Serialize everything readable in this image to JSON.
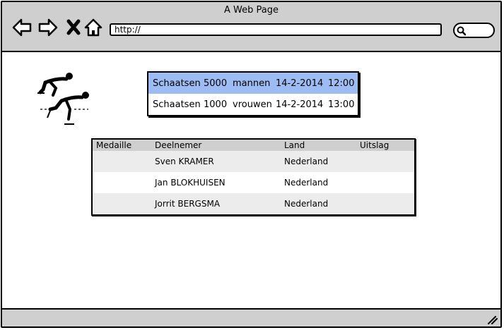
{
  "browser": {
    "title": "A Web Page",
    "url": "http://"
  },
  "events": [
    {
      "sport": "Schaatsen",
      "distance": "5000",
      "category": "mannen",
      "date": "14-2-2014",
      "time": "12:00",
      "selected": true
    },
    {
      "sport": "Schaatsen",
      "distance": "1000",
      "category": "vrouwen",
      "date": "14-2-2014",
      "time": "13:00",
      "selected": false
    }
  ],
  "results": {
    "headers": [
      "Medaille",
      "Deelnemer",
      "Land",
      "Uitslag"
    ],
    "rows": [
      {
        "medal": "",
        "participant": "Sven KRAMER",
        "country": "Nederland",
        "result": ""
      },
      {
        "medal": "",
        "participant": "Jan BLOKHUISEN",
        "country": "Nederland",
        "result": ""
      },
      {
        "medal": "",
        "participant": "Jorrit BERGSMA",
        "country": "Nederland",
        "result": ""
      }
    ]
  },
  "colors": {
    "chrome": "#cfcfcf",
    "selection": "#9dbcf4",
    "row_alt": "#ececec"
  },
  "icons": [
    "back-icon",
    "forward-icon",
    "close-icon",
    "home-icon",
    "search-icon",
    "resize-grip-icon",
    "speed-skating-icon"
  ]
}
